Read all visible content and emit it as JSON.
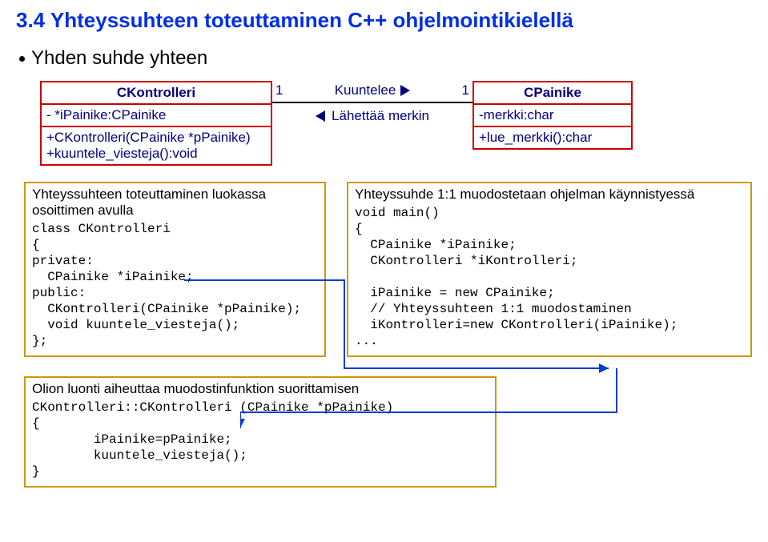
{
  "title": "3.4 Yhteyssuhteen toteuttaminen C++ ohjelmointikielellä",
  "subtitle": "Yhden suhde yhteen",
  "uml_left": {
    "name": "CKontrolleri",
    "attr": "- *iPainike:CPainike",
    "ops": "+CKontrolleri(CPainike *pPainike)\n+kuuntele_viesteja():void"
  },
  "assoc": {
    "left_mult": "1",
    "top_label": "Kuuntelee",
    "right_mult": "1",
    "bottom_label": "Lähettää merkin"
  },
  "uml_right": {
    "name": "CPainike",
    "attr": "-merkki:char",
    "ops": "+lue_merkki():char"
  },
  "code_left": {
    "caption": "Yhteyssuhteen toteuttaminen luokassa osoittimen avulla",
    "code": "class CKontrolleri\n{\nprivate:\n  CPainike *iPainike;\npublic:\n  CKontrolleri(CPainike *pPainike);\n  void kuuntele_viesteja();\n};"
  },
  "code_right": {
    "caption": "Yhteyssuhde 1:1 muodostetaan ohjelman käynnistyessä",
    "code": "void main()\n{\n  CPainike *iPainike;\n  CKontrolleri *iKontrolleri;\n\n  iPainike = new CPainike;\n  // Yhteyssuhteen 1:1 muodostaminen\n  iKontrolleri=new CKontrolleri(iPainike);\n..."
  },
  "code_bottom": {
    "caption": "Olion luonti aiheuttaa muodostinfunktion suorittamisen",
    "code": "CKontrolleri::CKontrolleri (CPainike *pPainike)\n{\n        iPainike=pPainike;\n        kuuntele_viesteja();\n}"
  }
}
